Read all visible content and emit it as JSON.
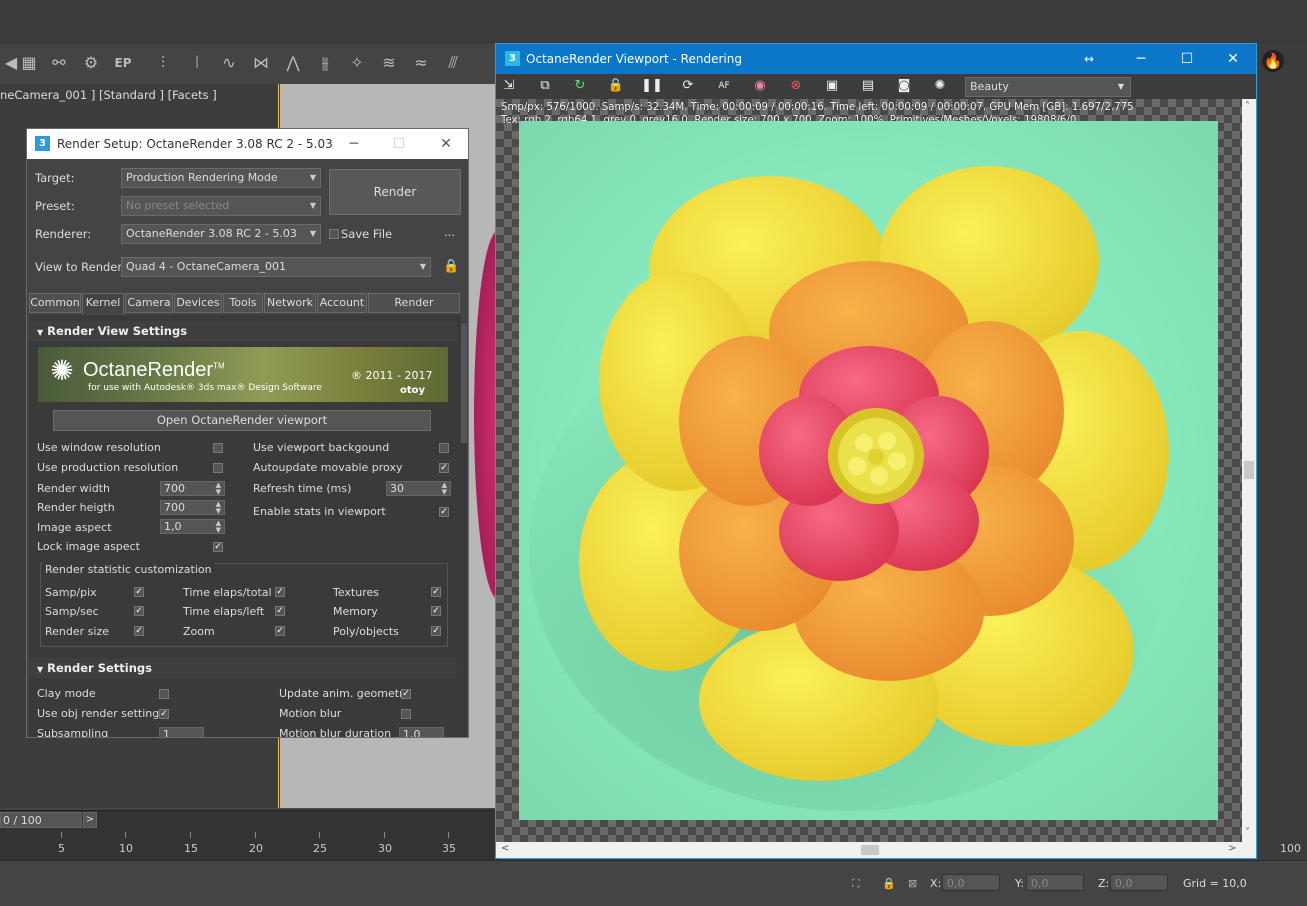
{
  "max": {
    "viewport_label": "neCamera_001 ] [Standard ] [Facets ]",
    "frame_counter": "0 / 100",
    "frame_next": ">",
    "timeline_ticks": [
      "5",
      "10",
      "15",
      "20",
      "25",
      "30",
      "35"
    ],
    "timeline_end": "100",
    "coords": {
      "x_label": "X:",
      "x_value": "0,0",
      "y_label": "Y:",
      "y_value": "0,0",
      "z_label": "Z:",
      "z_value": "0,0"
    },
    "grid": "Grid = 10,0",
    "toolbar_icons": [
      "teapot-icon",
      "link-icon",
      "gear-icon",
      "ep-icon",
      "hair-icon",
      "spiral-icon",
      "path-icon",
      "vertex-icon",
      "bend-icon",
      "light-icon",
      "wave-icon",
      "wave-icon-2",
      "brush-icon"
    ]
  },
  "render_setup": {
    "title": "Render Setup: OctaneRender 3.08 RC 2 - 5.03",
    "app_badge": "3",
    "target_label": "Target:",
    "target_value": "Production Rendering Mode",
    "preset_label": "Preset:",
    "preset_value": "No preset selected",
    "renderer_label": "Renderer:",
    "renderer_value": "OctaneRender 3.08 RC 2 - 5.03",
    "save_file_label": "Save File",
    "more": "...",
    "view_label": "View to Render:",
    "view_value": "Quad 4 - OctaneCamera_001",
    "render_button": "Render",
    "tabs": [
      "Common",
      "Kernel",
      "Camera",
      "Devices",
      "Tools",
      "Network",
      "Account",
      "Render Elements"
    ],
    "active_tab": "Kernel",
    "section1": "Render View Settings",
    "banner": {
      "name": "OctaneRender",
      "tm": "TM",
      "sub": "for use with Autodesk® 3ds max® Design Software",
      "year": "® 2011 - 2017",
      "brand": "otoy"
    },
    "open_viewport_button": "Open OctaneRender viewport",
    "left_options": [
      {
        "label": "Use window resolution",
        "checked": false
      },
      {
        "label": "Use production resolution",
        "checked": false
      }
    ],
    "right_options": [
      {
        "label": "Use viewport backgound",
        "checked": false
      },
      {
        "label": "Autoupdate movable proxy",
        "checked": true
      }
    ],
    "render_width_label": "Render width",
    "render_width": "700",
    "render_height_label": "Render heigth",
    "render_height": "700",
    "image_aspect_label": "Image aspect",
    "image_aspect": "1,0",
    "lock_aspect_label": "Lock image aspect",
    "refresh_label": "Refresh time (ms)",
    "refresh_value": "30",
    "stats_label": "Enable stats in viewport",
    "stat_box_title": "Render statistic customization",
    "stat_items": [
      [
        "Samp/pix",
        "Time elaps/total",
        "Textures"
      ],
      [
        "Samp/sec",
        "Time elaps/left",
        "Memory"
      ],
      [
        "Render size",
        "Zoom",
        "Poly/objects"
      ]
    ],
    "section2": "Render Settings",
    "rs_items": [
      {
        "label": "Clay mode",
        "checked": false
      },
      {
        "label": "Use obj render settings",
        "checked": true
      },
      {
        "label": "Subsampling",
        "value": "1"
      }
    ],
    "rs_items_right": [
      {
        "label": "Update anim. geometry",
        "checked": true
      },
      {
        "label": "Motion blur",
        "checked": false
      },
      {
        "label": "Motion blur duration",
        "value": "1,0"
      }
    ]
  },
  "viewport": {
    "title": "OctaneRender Viewport - Rendering",
    "app_badge": "3",
    "pass": "Beauty",
    "stats_line1": "Smp/px: 576/1000.   Samp/s: 32.34M.   Time: 00:00:09 / 00:00:16.   Time left: 00:00:09 / 00:00:07.   GPU Mem [GB]: 1.697/2.775",
    "stats_line2": "Tex: rgb 2, rgb64 1, grey 0, grey16 0.   Render size: 700 x 700.   Zoom: 100%.   Primitives/Meshes/Voxels: 19808/6/0",
    "colors": {
      "background": "#8ff0c4",
      "outer_petal": "#f5e03a",
      "middle_petal": "#f29a38",
      "inner_petal": "#ee4a6a",
      "center": "#eae24a"
    }
  }
}
